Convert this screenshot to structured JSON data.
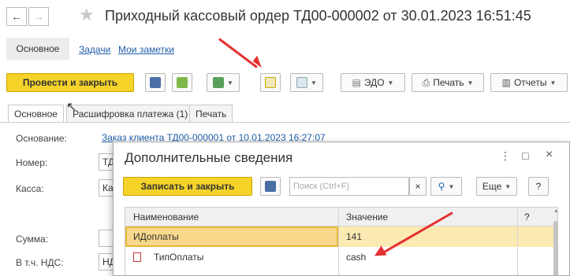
{
  "window": {
    "back_icon": "arrow-left-icon",
    "forward_icon": "arrow-right-icon",
    "favorite_icon": "star-icon",
    "title": "Приходный кассовый ордер ТД00-000002 от 30.01.2023 16:51:45"
  },
  "top_tabs": {
    "main": "Основное",
    "tasks": "Задачи",
    "notes": "Мои заметки"
  },
  "toolbar": {
    "post_close": "Провести и закрыть",
    "edo": "ЭДО",
    "print": "Печать",
    "reports": "Отчеты"
  },
  "form_tabs": {
    "main": "Основное",
    "payment_breakdown": "Расшифровка платежа (1)",
    "print": "Печать"
  },
  "form": {
    "basis_label": "Основание:",
    "basis_value": "Заказ клиента ТД00-000001 от 10.01.2023 16:27:07",
    "number_label": "Номер:",
    "number_value": "ТД",
    "cashbox_label": "Касса:",
    "cashbox_value": "Ка",
    "amount_label": "Сумма:",
    "vat_label": "В т.ч. НДС:",
    "vat_value": "НД"
  },
  "modal": {
    "title": "Дополнительные сведения",
    "write_close": "Записать и закрыть",
    "search_placeholder": "Поиск (Ctrl+F)",
    "more": "Еще",
    "help": "?",
    "menu_icon": "⋮",
    "maximize_icon": "□",
    "close_icon": "×",
    "columns": {
      "name": "Наименование",
      "value": "Значение",
      "extra": "?"
    },
    "rows": [
      {
        "name": "ИДоплаты",
        "value": "141"
      },
      {
        "name": "ТипОплаты",
        "value": "cash"
      }
    ]
  },
  "colors": {
    "accent_yellow": "#f5d329",
    "link_blue": "#1f5ea8",
    "arrow_red": "#e53030",
    "selected_row": "#fbeab2"
  }
}
